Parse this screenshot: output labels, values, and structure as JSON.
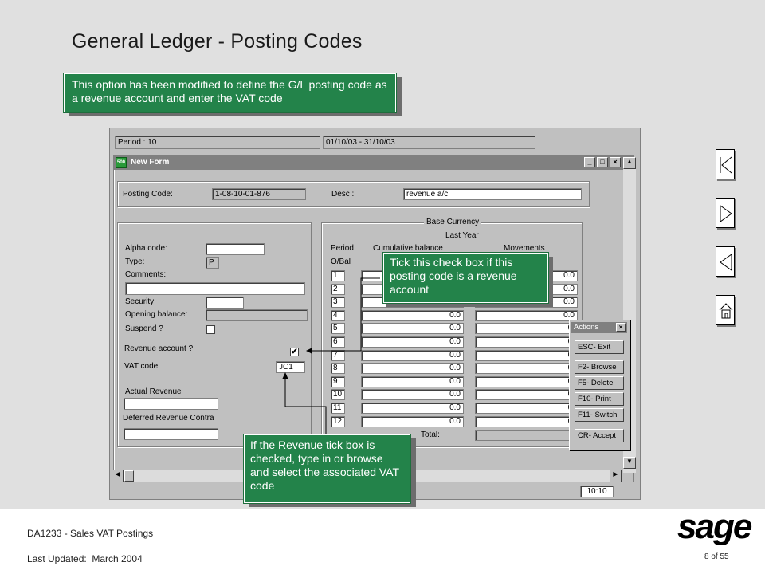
{
  "slide": {
    "title": "General Ledger - Posting Codes",
    "intro_callout": "This option has been modified to define the G/L posting code as a revenue account and enter the VAT code",
    "tick_callout": "Tick this check box if this posting code is a revenue account",
    "vat_callout": "If the Revenue tick box is checked, type in or browse and select the associated VAT code"
  },
  "app": {
    "period": "Period : 10",
    "date_range": "01/10/03 - 31/10/03",
    "window_title": "New Form",
    "window_icon": "500",
    "clock": "10:10"
  },
  "form": {
    "posting_code_label": "Posting Code:",
    "posting_code_value": "1-08-10-01-876",
    "desc_label": "Desc :",
    "desc_value": "revenue a/c",
    "alpha_code_label": "Alpha code:",
    "alpha_code_value": "",
    "type_label": "Type:",
    "type_value": "P",
    "comments_label": "Comments:",
    "comments_value": "",
    "security_label": "Security:",
    "opening_balance_label": "Opening balance:",
    "suspend_label": "Suspend ?",
    "revenue_account_label": "Revenue account ?",
    "revenue_checked": "✔",
    "vat_code_label": "VAT code",
    "vat_code_value": "JC1",
    "actual_revenue_label": "Actual Revenue",
    "deferred_revenue_label": "Deferred Revenue Contra"
  },
  "balances": {
    "base_currency": "Base Currency",
    "last_year": "Last Year",
    "period_header": "Period",
    "cumulative_header": "Cumulative balance",
    "movements_header": "Movements",
    "ob_label": "O/Bal",
    "total_label": "Total:",
    "rows": [
      {
        "period": "1",
        "cumulative": "",
        "movement": "0.0"
      },
      {
        "period": "2",
        "cumulative": "",
        "movement": "0.0"
      },
      {
        "period": "3",
        "cumulative": "",
        "movement": "0.0"
      },
      {
        "period": "4",
        "cumulative": "0.0",
        "movement": "0.0"
      },
      {
        "period": "5",
        "cumulative": "0.0",
        "movement": "0."
      },
      {
        "period": "6",
        "cumulative": "0.0",
        "movement": "0."
      },
      {
        "period": "7",
        "cumulative": "0.0",
        "movement": "0."
      },
      {
        "period": "8",
        "cumulative": "0.0",
        "movement": "0."
      },
      {
        "period": "9",
        "cumulative": "0.0",
        "movement": "0."
      },
      {
        "period": "10",
        "cumulative": "0.0",
        "movement": "0."
      },
      {
        "period": "11",
        "cumulative": "0.0",
        "movement": "0."
      },
      {
        "period": "12",
        "cumulative": "0.0",
        "movement": "0."
      }
    ]
  },
  "actions": {
    "title": "Actions",
    "items": [
      "ESC- Exit",
      "F2- Browse",
      "F5- Delete",
      "F10- Print",
      "F11- Switch",
      "CR- Accept"
    ]
  },
  "footer": {
    "course": "DA1233 - Sales VAT Postings",
    "updated": "Last Updated:  March 2004",
    "page": "8 of 55",
    "logo": "sage"
  },
  "nav_icons": [
    "first-slide-icon",
    "next-slide-icon",
    "previous-slide-icon",
    "home-icon"
  ],
  "colors": {
    "slide_bg": "#e0e0e0",
    "callout_green": "#23834a",
    "window_grey": "#c0c0c0"
  }
}
